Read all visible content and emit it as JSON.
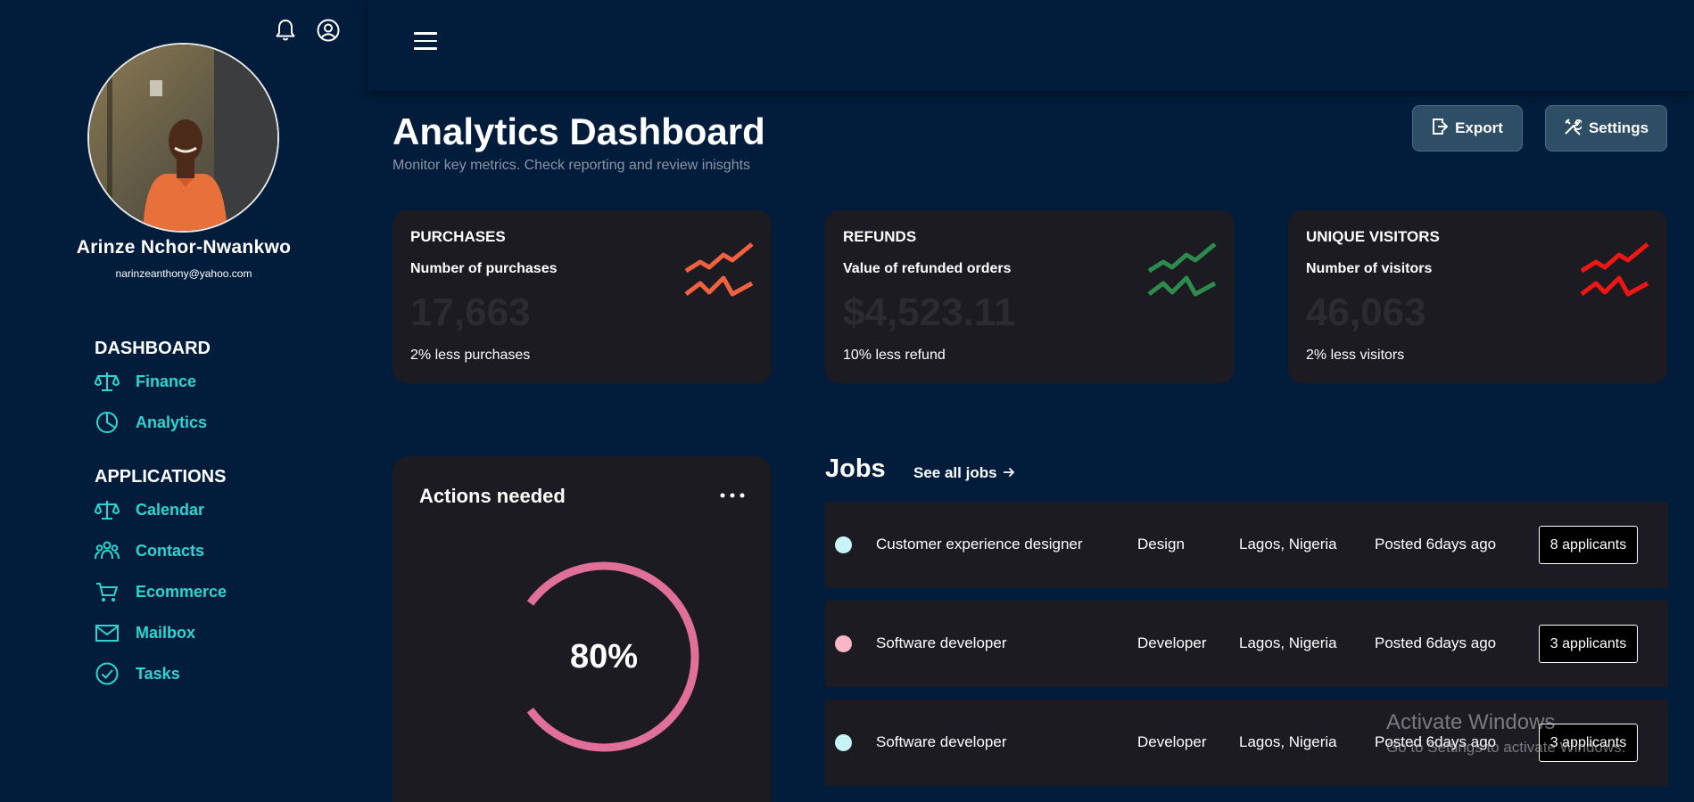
{
  "user": {
    "name": "Arinze Nchor-Nwankwo",
    "email": "narinzeanthony@yahoo.com"
  },
  "sidebar": {
    "sections": [
      {
        "title": "DASHBOARD",
        "items": [
          {
            "label": "Finance",
            "icon": "scale-icon"
          },
          {
            "label": "Analytics",
            "icon": "pie-chart-icon"
          }
        ]
      },
      {
        "title": "APPLICATIONS",
        "items": [
          {
            "label": "Calendar",
            "icon": "scale-icon"
          },
          {
            "label": "Contacts",
            "icon": "users-icon"
          },
          {
            "label": "Ecommerce",
            "icon": "cart-icon"
          },
          {
            "label": "Mailbox",
            "icon": "mail-icon"
          },
          {
            "label": "Tasks",
            "icon": "check-circle-icon"
          }
        ]
      }
    ]
  },
  "header": {
    "title": "Analytics Dashboard",
    "subtitle": "Monitor key metrics. Check reporting and review inisghts",
    "export_label": "Export",
    "settings_label": "Settings"
  },
  "stats": [
    {
      "title": "PURCHASES",
      "subtitle": "Number of purchases",
      "value": "17,663",
      "note": "2% less purchases",
      "trend_color": "#f0623f"
    },
    {
      "title": "REFUNDS",
      "subtitle": "Value of refunded orders",
      "value": "$4,523.11",
      "note": "10% less refund",
      "trend_color": "#2e8b4e"
    },
    {
      "title": "UNIQUE VISITORS",
      "subtitle": "Number of visitors",
      "value": "46,063",
      "note": "2% less visitors",
      "trend_color": "#ef1616"
    }
  ],
  "actions": {
    "title": "Actions needed",
    "percent_label": "80%",
    "progress": 0.8,
    "ring_color": "#e07097"
  },
  "jobs": {
    "title": "Jobs",
    "see_all": "See all jobs",
    "rows": [
      {
        "title": "Customer experience designer",
        "category": "Design",
        "location": "Lagos, Nigeria",
        "posted": "Posted 6days ago",
        "applicants": "8 applicants",
        "dot_color": "#c8f3f7"
      },
      {
        "title": "Software developer",
        "category": "Developer",
        "location": "Lagos, Nigeria",
        "posted": "Posted 6days ago",
        "applicants": "3 applicants",
        "dot_color": "#f8b6c6"
      },
      {
        "title": "Software developer",
        "category": "Developer",
        "location": "Lagos, Nigeria",
        "posted": "Posted 6days ago",
        "applicants": "3 applicants",
        "dot_color": "#c8f3f7"
      }
    ]
  },
  "watermark": {
    "line1": "Activate Windows",
    "line2": "Go to Settings to activate Windows."
  },
  "colors": {
    "background": "#021d3b",
    "card": "#1b1b21",
    "accent": "#2dd4d0"
  }
}
